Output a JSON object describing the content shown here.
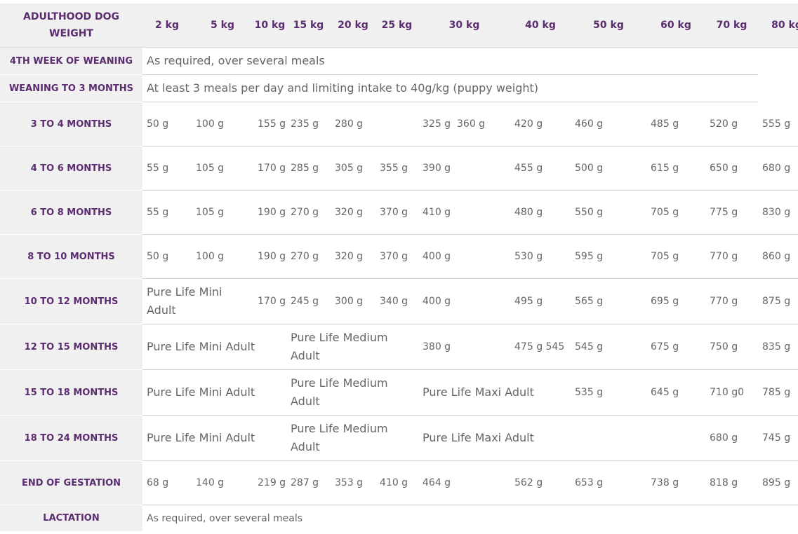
{
  "table": {
    "header": {
      "row_label": "ADULTHOOD DOG WEIGHT",
      "weights": [
        "2 kg",
        "5 kg",
        "10 kg",
        "15 kg",
        "20 kg",
        "25 kg",
        "30 kg",
        "40 kg",
        "50 kg",
        "60 kg",
        "70 kg",
        "80 kg"
      ]
    },
    "rows": [
      {
        "label": "4TH WEEK OF WEANING",
        "cells": [
          {
            "text": "As required, over several meals",
            "span": 12
          }
        ]
      },
      {
        "label": "WEANING TO 3 MONTHS",
        "cells": [
          {
            "text": "At least 3 meals per day and limiting intake to 40g/kg (puppy weight)",
            "span": 12
          }
        ]
      },
      {
        "label": "3 TO 4 MONTHS",
        "cells": [
          {
            "text": "50 g"
          },
          {
            "text": "100 g"
          },
          {
            "text": "155 g"
          },
          {
            "text": "235 g"
          },
          {
            "text": "280 g"
          },
          {
            "text": ""
          },
          {
            "text": "325 g"
          },
          {
            "text": "360 g"
          },
          {
            "text": "420 g"
          },
          {
            "text": "460 g"
          },
          {
            "text": "485 g"
          },
          {
            "text": "520 g"
          },
          {
            "text": "555 g"
          }
        ]
      },
      {
        "label": "4 TO 6 MONTHS",
        "cells": [
          {
            "text": "55 g"
          },
          {
            "text": "105 g"
          },
          {
            "text": "170 g"
          },
          {
            "text": "285 g"
          },
          {
            "text": "305 g"
          },
          {
            "text": "355 g"
          },
          {
            "text": "390 g",
            "span": 2
          },
          {
            "text": "455 g"
          },
          {
            "text": "500 g"
          },
          {
            "text": "615 g"
          },
          {
            "text": "650 g"
          },
          {
            "text": "680 g"
          }
        ]
      },
      {
        "label": "6 TO 8 MONTHS",
        "cells": [
          {
            "text": "55 g"
          },
          {
            "text": "105 g"
          },
          {
            "text": "190 g"
          },
          {
            "text": "270 g"
          },
          {
            "text": "320 g"
          },
          {
            "text": "370 g"
          },
          {
            "text": "410 g",
            "span": 2
          },
          {
            "text": "480 g"
          },
          {
            "text": "550 g"
          },
          {
            "text": "705 g"
          },
          {
            "text": "775 g"
          },
          {
            "text": "830 g"
          }
        ]
      },
      {
        "label": "8 TO 10 MONTHS",
        "cells": [
          {
            "text": "50 g"
          },
          {
            "text": "100 g"
          },
          {
            "text": "190 g"
          },
          {
            "text": "270 g"
          },
          {
            "text": "320 g"
          },
          {
            "text": "370 g"
          },
          {
            "text": "400 g",
            "span": 2
          },
          {
            "text": "530 g"
          },
          {
            "text": "595 g"
          },
          {
            "text": "705 g"
          },
          {
            "text": "770 g"
          },
          {
            "text": "860 g"
          }
        ]
      },
      {
        "label": "10 TO 12 MONTHS",
        "cells": [
          {
            "text": "Pure Life Mini Adult",
            "span": 2,
            "big": true
          },
          {
            "text": "170 g"
          },
          {
            "text": "245 g"
          },
          {
            "text": "300 g"
          },
          {
            "text": "340 g"
          },
          {
            "text": "400 g",
            "span": 2
          },
          {
            "text": "495 g"
          },
          {
            "text": "565 g"
          },
          {
            "text": "695 g"
          },
          {
            "text": "770 g"
          },
          {
            "text": "875 g"
          }
        ]
      },
      {
        "label": "12 TO 15 MONTHS",
        "cells": [
          {
            "text": "Pure Life Mini Adult",
            "span": 3,
            "big": true
          },
          {
            "text": "Pure Life Medium Adult",
            "span": 3,
            "big": true
          },
          {
            "text": "380 g",
            "span": 2
          },
          {
            "text": "475 g 545"
          },
          {
            "text": "545 g"
          },
          {
            "text": "675 g"
          },
          {
            "text": "750 g"
          },
          {
            "text": "835 g"
          }
        ]
      },
      {
        "label": "15 TO 18 MONTHS",
        "cells": [
          {
            "text": "Pure Life Mini Adult",
            "span": 3,
            "big": true
          },
          {
            "text": "Pure Life Medium Adult",
            "span": 3,
            "big": true
          },
          {
            "text": "Pure Life Maxi Adult",
            "span": 3,
            "big": true
          },
          {
            "text": "535 g"
          },
          {
            "text": "645 g"
          },
          {
            "text": "710 g0"
          },
          {
            "text": "785 g"
          }
        ]
      },
      {
        "label": "18 TO 24 MONTHS",
        "cells": [
          {
            "text": "Pure Life Mini Adult",
            "span": 3,
            "big": true
          },
          {
            "text": "Pure Life Medium Adult",
            "span": 3,
            "big": true
          },
          {
            "text": "Pure Life Maxi Adult",
            "span": 3,
            "big": true
          },
          {
            "text": ""
          },
          {
            "text": ""
          },
          {
            "text": "680 g"
          },
          {
            "text": "745 g"
          }
        ]
      },
      {
        "label": "END OF GESTATION",
        "cells": [
          {
            "text": "68 g"
          },
          {
            "text": "140 g"
          },
          {
            "text": "219 g"
          },
          {
            "text": "287 g"
          },
          {
            "text": "353 g"
          },
          {
            "text": "410 g"
          },
          {
            "text": "464 g",
            "span": 2
          },
          {
            "text": "562 g"
          },
          {
            "text": "653 g"
          },
          {
            "text": "738 g"
          },
          {
            "text": "818 g"
          },
          {
            "text": "895 g"
          }
        ]
      },
      {
        "label": "LACTATION",
        "cells": [
          {
            "text": "As required, over several meals",
            "span": 12,
            "small": true
          }
        ]
      }
    ]
  }
}
